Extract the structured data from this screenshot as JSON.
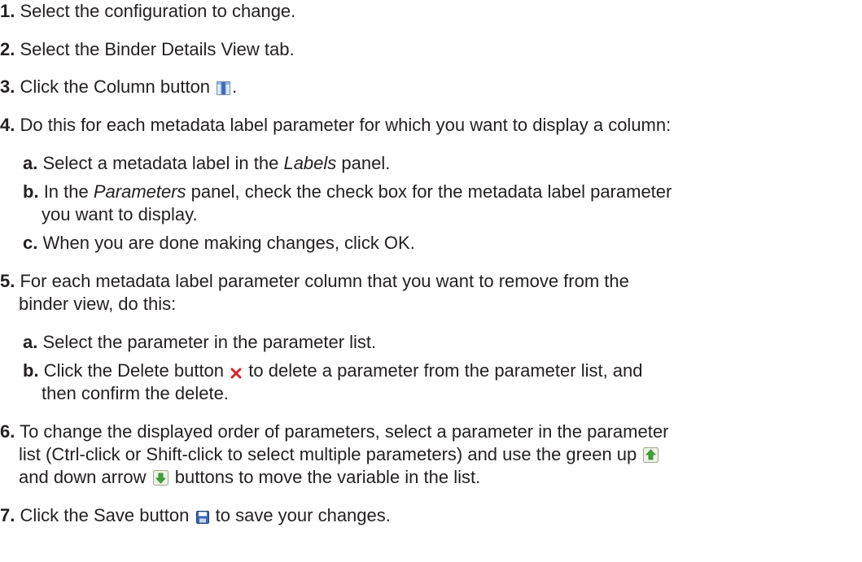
{
  "steps": [
    {
      "num": "1.",
      "text": "Select the configuration to change."
    },
    {
      "num": "2.",
      "text": "Select the Binder Details View tab."
    },
    {
      "num": "3.",
      "pre": "Click the Column button",
      "post": ".",
      "icon": "column-icon"
    },
    {
      "num": "4.",
      "text": "Do this for each metadata label parameter for which you want to display a column:",
      "substeps": [
        {
          "num": "a.",
          "pre": "Select a metadata label in the ",
          "em": "Labels",
          "post": " panel."
        },
        {
          "num": "b.",
          "pre": "In the ",
          "em": "Parameters",
          "post": " panel, check the check box for the metadata label parameter",
          "cont": "you want to display."
        },
        {
          "num": "c.",
          "text": "When you are done making changes, click OK."
        }
      ]
    },
    {
      "num": "5.",
      "text": "For each metadata label parameter column that you want to remove from the",
      "cont": "binder view, do this:",
      "substeps": [
        {
          "num": "a.",
          "text": "Select the parameter in the parameter list."
        },
        {
          "num": "b.",
          "pre": "Click the Delete button",
          "post": " to delete a parameter from the parameter list, and",
          "icon": "delete-icon",
          "cont": "then confirm the delete."
        }
      ]
    },
    {
      "num": "6.",
      "text": "To change the displayed order of parameters, select a parameter in the parameter",
      "cont1_pre": "list (Ctrl-click or Shift-click to select multiple parameters) and use the green up",
      "cont2_pre": "and down arrow",
      "cont2_post": "buttons to move the variable in the list.",
      "icons": [
        "up-arrow-icon",
        "down-arrow-icon"
      ]
    },
    {
      "num": "7.",
      "pre": "Click the Save button",
      "post": " to save your changes.",
      "icon": "save-icon"
    }
  ]
}
